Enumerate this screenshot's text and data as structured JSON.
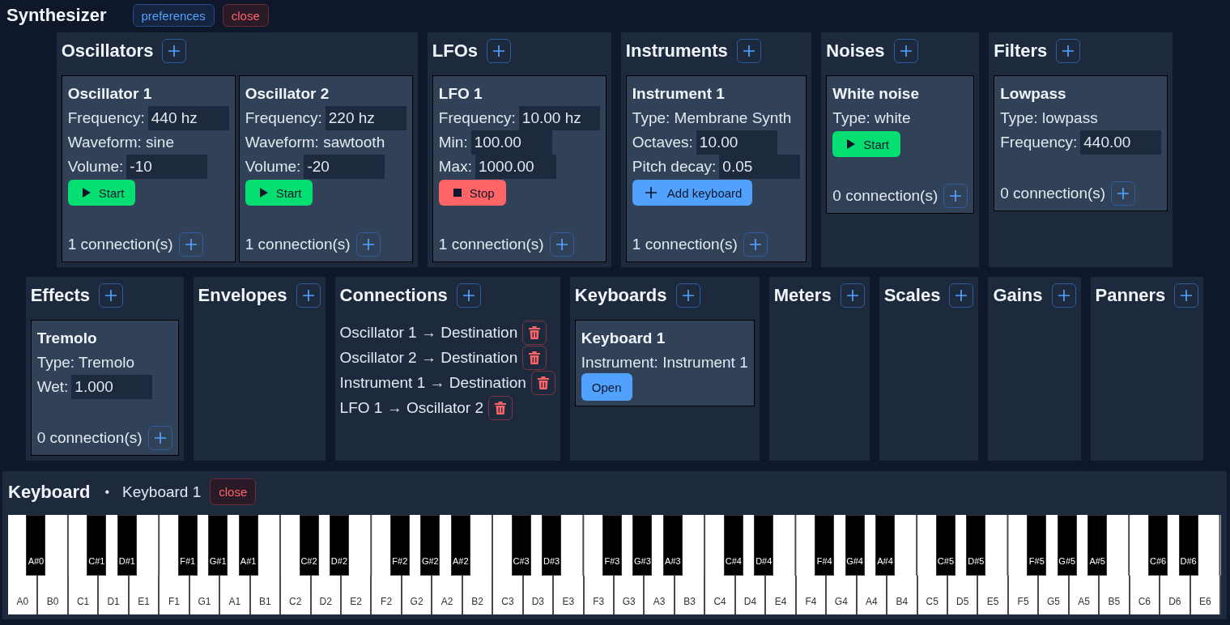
{
  "header": {
    "title": "Synthesizer",
    "buttons": [
      {
        "kind": "preferences",
        "label": "preferences"
      },
      {
        "kind": "close",
        "label": "close"
      }
    ]
  },
  "panel_rows": [
    [
      {
        "title": "Oscillators",
        "cards": [
          {
            "title": "Oscillator 1",
            "lines": [
              {
                "kind": "input",
                "label": "Frequency:",
                "value": "440 hz"
              },
              {
                "kind": "text",
                "text": "Waveform: sine"
              },
              {
                "kind": "input",
                "label": "Volume:",
                "value": "-10"
              }
            ],
            "button": {
              "kind": "start",
              "label": "Start"
            },
            "connection_count": "1 connection(s)"
          },
          {
            "title": "Oscillator 2",
            "lines": [
              {
                "kind": "input",
                "label": "Frequency:",
                "value": "220 hz"
              },
              {
                "kind": "text",
                "text": "Waveform: sawtooth"
              },
              {
                "kind": "input",
                "label": "Volume:",
                "value": "-20"
              }
            ],
            "button": {
              "kind": "start",
              "label": "Start"
            },
            "connection_count": "1 connection(s)"
          }
        ]
      },
      {
        "title": "LFOs",
        "cards": [
          {
            "title": "LFO 1",
            "lines": [
              {
                "kind": "input",
                "label": "Frequency:",
                "value": "10.00 hz"
              },
              {
                "kind": "input",
                "label": "Min:",
                "value": "100.00"
              },
              {
                "kind": "input",
                "label": "Max:",
                "value": "1000.00"
              }
            ],
            "button": {
              "kind": "stop",
              "label": "Stop"
            },
            "connection_count": "1 connection(s)"
          }
        ]
      },
      {
        "title": "Instruments",
        "cards": [
          {
            "title": "Instrument 1",
            "lines": [
              {
                "kind": "text",
                "text": "Type: Membrane Synth"
              },
              {
                "kind": "input",
                "label": "Octaves:",
                "value": "10.00"
              },
              {
                "kind": "input",
                "label": "Pitch decay:",
                "value": "0.05"
              }
            ],
            "button": {
              "kind": "add",
              "label": "Add keyboard"
            },
            "connection_count": "1 connection(s)"
          }
        ]
      },
      {
        "title": "Noises",
        "cards": [
          {
            "title": "White noise",
            "lines": [
              {
                "kind": "text",
                "text": "Type: white"
              }
            ],
            "button": {
              "kind": "start",
              "label": "Start"
            },
            "connection_count": "0 connection(s)"
          }
        ]
      },
      {
        "title": "Filters",
        "cards": [
          {
            "title": "Lowpass",
            "lines": [
              {
                "kind": "text",
                "text": "Type: lowpass"
              },
              {
                "kind": "input",
                "label": "Frequency:",
                "value": "440.00"
              }
            ],
            "connection_count": "0 connection(s)"
          }
        ]
      }
    ],
    [
      {
        "title": "Effects",
        "cards": [
          {
            "title": "Tremolo",
            "lines": [
              {
                "kind": "text",
                "text": "Type: Tremolo"
              },
              {
                "kind": "input",
                "label": "Wet:",
                "value": "1.000"
              }
            ],
            "connection_count": "0 connection(s)"
          }
        ]
      },
      {
        "title": "Envelopes"
      },
      {
        "title": "Connections",
        "connections": [
          "Oscillator 1 → Destination",
          "Oscillator 2 → Destination",
          "Instrument 1 → Destination",
          "LFO 1 → Oscillator 2"
        ]
      },
      {
        "title": "Keyboards",
        "cards": [
          {
            "title": "Keyboard 1",
            "lines": [
              {
                "kind": "text",
                "text": "Instrument: Instrument 1"
              }
            ],
            "button": {
              "kind": "open",
              "label": "Open"
            }
          }
        ]
      },
      {
        "title": "Meters"
      },
      {
        "title": "Scales"
      },
      {
        "title": "Gains"
      },
      {
        "title": "Panners"
      }
    ]
  ],
  "keyboard": {
    "title": "Keyboard",
    "separator": "•",
    "name": "Keyboard 1",
    "close_button": "close",
    "keys": [
      {
        "label": "A0",
        "kind": "natural"
      },
      {
        "label": "A#0",
        "kind": "sharp"
      },
      {
        "label": "B0",
        "kind": "natural"
      },
      {
        "label": "C1",
        "kind": "natural"
      },
      {
        "label": "C#1",
        "kind": "sharp"
      },
      {
        "label": "D1",
        "kind": "natural"
      },
      {
        "label": "D#1",
        "kind": "sharp"
      },
      {
        "label": "E1",
        "kind": "natural"
      },
      {
        "label": "F1",
        "kind": "natural"
      },
      {
        "label": "F#1",
        "kind": "sharp"
      },
      {
        "label": "G1",
        "kind": "natural"
      },
      {
        "label": "G#1",
        "kind": "sharp"
      },
      {
        "label": "A1",
        "kind": "natural"
      },
      {
        "label": "A#1",
        "kind": "sharp"
      },
      {
        "label": "B1",
        "kind": "natural"
      },
      {
        "label": "C2",
        "kind": "natural"
      },
      {
        "label": "C#2",
        "kind": "sharp"
      },
      {
        "label": "D2",
        "kind": "natural"
      },
      {
        "label": "D#2",
        "kind": "sharp"
      },
      {
        "label": "E2",
        "kind": "natural"
      },
      {
        "label": "F2",
        "kind": "natural"
      },
      {
        "label": "F#2",
        "kind": "sharp"
      },
      {
        "label": "G2",
        "kind": "natural"
      },
      {
        "label": "G#2",
        "kind": "sharp"
      },
      {
        "label": "A2",
        "kind": "natural"
      },
      {
        "label": "A#2",
        "kind": "sharp"
      },
      {
        "label": "B2",
        "kind": "natural"
      },
      {
        "label": "C3",
        "kind": "natural"
      },
      {
        "label": "C#3",
        "kind": "sharp"
      },
      {
        "label": "D3",
        "kind": "natural"
      },
      {
        "label": "D#3",
        "kind": "sharp"
      },
      {
        "label": "E3",
        "kind": "natural"
      },
      {
        "label": "F3",
        "kind": "natural"
      },
      {
        "label": "F#3",
        "kind": "sharp"
      },
      {
        "label": "G3",
        "kind": "natural"
      },
      {
        "label": "G#3",
        "kind": "sharp"
      },
      {
        "label": "A3",
        "kind": "natural"
      },
      {
        "label": "A#3",
        "kind": "sharp"
      },
      {
        "label": "B3",
        "kind": "natural"
      },
      {
        "label": "C4",
        "kind": "natural"
      },
      {
        "label": "C#4",
        "kind": "sharp"
      },
      {
        "label": "D4",
        "kind": "natural"
      },
      {
        "label": "D#4",
        "kind": "sharp"
      },
      {
        "label": "E4",
        "kind": "natural"
      },
      {
        "label": "F4",
        "kind": "natural"
      },
      {
        "label": "F#4",
        "kind": "sharp"
      },
      {
        "label": "G4",
        "kind": "natural"
      },
      {
        "label": "G#4",
        "kind": "sharp"
      },
      {
        "label": "A4",
        "kind": "natural"
      },
      {
        "label": "A#4",
        "kind": "sharp"
      },
      {
        "label": "B4",
        "kind": "natural"
      },
      {
        "label": "C5",
        "kind": "natural"
      },
      {
        "label": "C#5",
        "kind": "sharp"
      },
      {
        "label": "D5",
        "kind": "natural"
      },
      {
        "label": "D#5",
        "kind": "sharp"
      },
      {
        "label": "E5",
        "kind": "natural"
      },
      {
        "label": "F5",
        "kind": "natural"
      },
      {
        "label": "F#5",
        "kind": "sharp"
      },
      {
        "label": "G5",
        "kind": "natural"
      },
      {
        "label": "G#5",
        "kind": "sharp"
      },
      {
        "label": "A5",
        "kind": "natural"
      },
      {
        "label": "A#5",
        "kind": "sharp"
      },
      {
        "label": "B5",
        "kind": "natural"
      },
      {
        "label": "C6",
        "kind": "natural"
      },
      {
        "label": "C#6",
        "kind": "sharp"
      },
      {
        "label": "D6",
        "kind": "natural"
      },
      {
        "label": "D#6",
        "kind": "sharp"
      },
      {
        "label": "E6",
        "kind": "natural"
      }
    ]
  }
}
